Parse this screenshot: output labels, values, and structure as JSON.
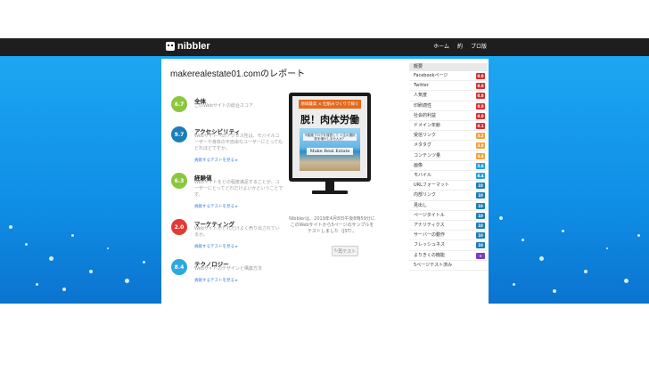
{
  "header": {
    "logo_text": "nibbler",
    "nav": [
      "ホーム",
      "約",
      "プロ版"
    ]
  },
  "report": {
    "title": "makerealestate01.comのレポート"
  },
  "metrics": [
    {
      "score": "6.7",
      "name": "全体",
      "desc": "このWebサイトの総合スコア",
      "link": "",
      "color": "#8cc63f"
    },
    {
      "score": "9.7",
      "name": "アクセシビリティ",
      "desc": "Webサイトへのアクセス性は、モバイルユーザーや身体の不自由なユーザーにとってもどれほどですか。",
      "link": "貢献するテストを見る ▸",
      "color": "#1b7db8"
    },
    {
      "score": "6.3",
      "name": "経験値",
      "desc": "Webサイトをどの程度満足することが、ユーザーにとってどれだけよいかということです。",
      "link": "貢献するテストを見る ▸",
      "color": "#8cc63f"
    },
    {
      "score": "2.0",
      "name": "マーケティング",
      "desc": "Webサイトがどれだけよく売り出されているか。",
      "link": "貢献するテストを見る ▸",
      "color": "#e53935"
    },
    {
      "score": "8.4",
      "name": "テクノロジー",
      "desc": "Webサイトのデザインと構築方法",
      "link": "貢献するテストを見る ▸",
      "color": "#29a9e0"
    }
  ],
  "monitor": {
    "promo_top": "地域最高 × 仕組みづくりで稼ぐ",
    "promo_main": "脱！肉体労働",
    "promo_sub": "不動産ブログを運営して 人生の選択肢を増やしませんか？",
    "promo_label": "Make Real Estate",
    "caption": "Nibblerは、2019年4月8日午後8時59分にこのWebサイトから5ページのサンプルをテストしました（JST）。",
    "retest_label": "再テスト"
  },
  "sidebar": {
    "header": "概要",
    "items": [
      {
        "label": "Facebookページ",
        "score": "0.0",
        "color": "#d32f2f"
      },
      {
        "label": "Twitter",
        "score": "0.0",
        "color": "#d32f2f"
      },
      {
        "label": "人気度",
        "score": "0.0",
        "color": "#d32f2f"
      },
      {
        "label": "印刷適性",
        "score": "0.0",
        "color": "#d32f2f"
      },
      {
        "label": "社会的利益",
        "score": "0.0",
        "color": "#d32f2f"
      },
      {
        "label": "ドメイン年齢",
        "score": "0.1",
        "color": "#d32f2f"
      },
      {
        "label": "受信リンク",
        "score": "3.2",
        "color": "#f0a13c"
      },
      {
        "label": "メタタグ",
        "score": "3.9",
        "color": "#f0a13c"
      },
      {
        "label": "コンテンツ量",
        "score": "4.4",
        "color": "#f0a13c"
      },
      {
        "label": "画像",
        "score": "5.6",
        "color": "#1ea0e0"
      },
      {
        "label": "モバイル",
        "score": "8.4",
        "color": "#1ea0e0"
      },
      {
        "label": "URLフォーマット",
        "score": "10",
        "color": "#1b7db8"
      },
      {
        "label": "内部リンク",
        "score": "10",
        "color": "#1b7db8"
      },
      {
        "label": "見出し",
        "score": "10",
        "color": "#1b7db8"
      },
      {
        "label": "ページタイトル",
        "score": "10",
        "color": "#1b7db8"
      },
      {
        "label": "アナリティクス",
        "score": "10",
        "color": "#1b7db8"
      },
      {
        "label": "サーバーの動作",
        "score": "10",
        "color": "#1b7db8"
      },
      {
        "label": "フレッシュネス",
        "score": "10",
        "color": "#1b7db8"
      },
      {
        "label": "よりきくの機能",
        "score": "+",
        "color": "#7b3fbf"
      },
      {
        "label": "5ページテスト済み",
        "score": "",
        "color": "#ffffff"
      }
    ]
  }
}
